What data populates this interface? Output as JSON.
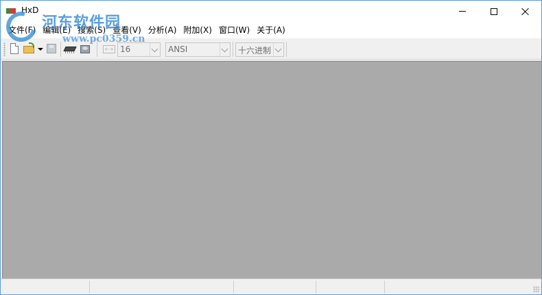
{
  "window": {
    "title": "HxD",
    "icon_name": "hxd-app-icon",
    "controls": {
      "minimize_icon": "minimize-icon",
      "maximize_icon": "maximize-icon",
      "close_icon": "close-icon"
    }
  },
  "watermark": {
    "site_name": "河东软件园",
    "url": "www.pc0359.cn"
  },
  "menu": {
    "items": [
      {
        "label": "文件(F)"
      },
      {
        "label": "编辑(E)"
      },
      {
        "label": "搜索(S)"
      },
      {
        "label": "查看(V)"
      },
      {
        "label": "分析(A)"
      },
      {
        "label": "附加(X)"
      },
      {
        "label": "窗口(W)"
      },
      {
        "label": "关于(A)"
      }
    ]
  },
  "toolbar": {
    "buttons": [
      {
        "icon": "new-file-icon"
      },
      {
        "icon": "open-file-icon"
      },
      {
        "icon": "dropdown-arrow-icon"
      },
      {
        "icon": "save-icon"
      },
      {
        "icon": "open-ram-icon"
      },
      {
        "icon": "open-disk-icon"
      },
      {
        "icon": "bytes-per-row-icon"
      }
    ],
    "bytes_per_row": {
      "value": "16"
    },
    "charset": {
      "value": "ANSI"
    },
    "offset_base": {
      "value": "十六进制"
    }
  },
  "status_bar": {
    "panels": [
      "",
      "",
      "",
      "",
      ""
    ]
  },
  "colors": {
    "workspace_bg": "#aaaaaa",
    "chrome_bg": "#f0f0f0",
    "window_border": "#5b9bd5",
    "watermark_blue": "#348ad6"
  }
}
